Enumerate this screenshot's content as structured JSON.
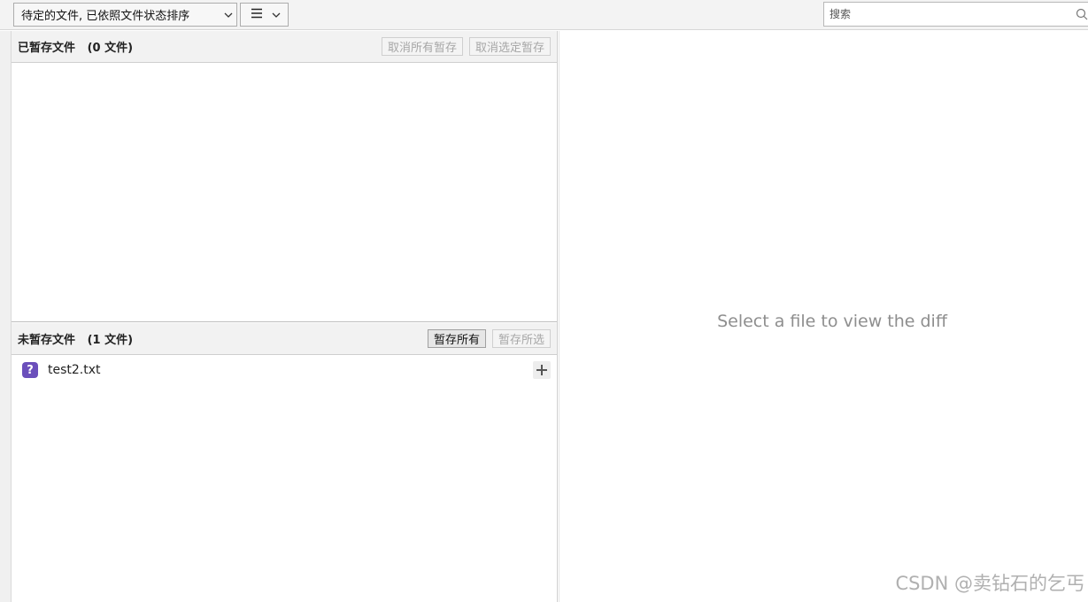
{
  "toolbar": {
    "filter_label": "待定的文件, 已依照文件状态排序",
    "search_placeholder": "搜索"
  },
  "staged": {
    "title": "已暂存文件",
    "count": "(0 文件)",
    "unstage_all_label": "取消所有暂存",
    "unstage_selected_label": "取消选定暂存"
  },
  "unstaged": {
    "title": "未暂存文件",
    "count": "(1 文件)",
    "stage_all_label": "暂存所有",
    "stage_selected_label": "暂存所选",
    "files": [
      {
        "name": "test2.txt",
        "status_icon": "question-mark-icon",
        "status_color": "#6b4fbb"
      }
    ]
  },
  "diff": {
    "empty_message": "Select a file to view the diff"
  },
  "watermark": "CSDN @卖钻石的乞丐",
  "colors": {
    "untracked_badge": "#6b4fbb",
    "header_bg": "#f2f2f2"
  }
}
